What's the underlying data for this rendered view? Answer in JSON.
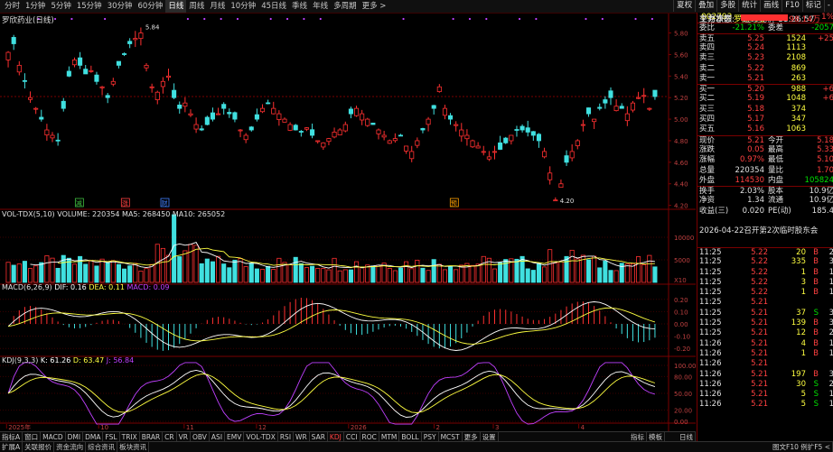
{
  "toolbar": {
    "items": [
      "分时",
      "1分钟",
      "5分钟",
      "15分钟",
      "30分钟",
      "60分钟",
      "日线",
      "周线",
      "月线",
      "10分钟",
      "45日线",
      "季线",
      "年线",
      "多周期",
      "更多 >"
    ],
    "selected": 6,
    "right_tools": [
      "夏权",
      "叠加",
      "多股",
      "统计",
      "画线",
      "F10",
      "标记",
      "-"
    ]
  },
  "chart": {
    "title": "罗欣药业(日线)",
    "high_label": "5.84",
    "low_label": "4.20",
    "price_ticks": [
      "5.80",
      "5.60",
      "5.40",
      "5.20",
      "5.00",
      "4.80",
      "4.60",
      "4.40",
      "4.20"
    ],
    "event_tags": [
      "减",
      "涨",
      "财",
      "预"
    ],
    "vol_label": "VOL-TDX(5,10)",
    "vol_values": "VOLUME: 220354  MA5: 268450  MA10: 265052",
    "vol_ticks": [
      "10000",
      "5000"
    ],
    "vol_unit": "X10",
    "macd_label": "MACD(6,26,9)",
    "macd_dif": "DIF: 0.16",
    "macd_dea": "DEA: 0.11",
    "macd_macd": "MACD: 0.09",
    "macd_ticks": [
      "0.20",
      "0.10",
      "0.00",
      "-0.10",
      "-0.20"
    ],
    "kdj_label": "KDJ(9,3,3)",
    "kdj_k": "K: 61.26",
    "kdj_d": "D: 63.47",
    "kdj_j": "J: 56.84",
    "kdj_ticks": [
      "100.00",
      "80.00",
      "50.00",
      "20.00",
      "0.00"
    ],
    "dates": [
      "2025年",
      "10",
      "11",
      "12",
      "2026",
      "2",
      "3",
      "4"
    ]
  },
  "bottom_tabs": {
    "row1": [
      "指标A",
      "窗口",
      "MACD",
      "DMI",
      "DMA",
      "FSL",
      "TRIX",
      "BRAR",
      "CR",
      "VR",
      "OBV",
      "ASI",
      "EMV",
      "VOL-TDX",
      "RSI",
      "WR",
      "SAR",
      "KDJ",
      "CCI",
      "ROC",
      "MTM",
      "BOLL",
      "PSY",
      "MCST",
      "更多",
      "设置"
    ],
    "row1_right": [
      "指标",
      "模板"
    ],
    "row1_end": "日线",
    "row2": [
      "扩展A",
      "关联报价",
      "资金流向",
      "综合资讯",
      "板块资讯"
    ],
    "row2_right": "图文F10 例扩F5 <"
  },
  "panel": {
    "code": "002793",
    "name": "罗欣药业",
    "weibi_label": "委比",
    "weibi_value": "-21.21%",
    "weicha_label": "委差",
    "weicha_value": "-2057",
    "sells": [
      {
        "label": "卖五",
        "price": "5.25",
        "vol": "1524",
        "chg": "+25"
      },
      {
        "label": "卖四",
        "price": "5.24",
        "vol": "1113",
        "chg": ""
      },
      {
        "label": "卖三",
        "price": "5.23",
        "vol": "2108",
        "chg": ""
      },
      {
        "label": "卖二",
        "price": "5.22",
        "vol": "869",
        "chg": ""
      },
      {
        "label": "卖一",
        "price": "5.21",
        "vol": "263",
        "chg": ""
      }
    ],
    "buys": [
      {
        "label": "买一",
        "price": "5.20",
        "vol": "988",
        "chg": "+6"
      },
      {
        "label": "买二",
        "price": "5.19",
        "vol": "1048",
        "chg": "+6"
      },
      {
        "label": "买三",
        "price": "5.18",
        "vol": "374",
        "chg": ""
      },
      {
        "label": "买四",
        "price": "5.17",
        "vol": "347",
        "chg": ""
      },
      {
        "label": "买五",
        "price": "5.16",
        "vol": "1063",
        "chg": ""
      }
    ],
    "stats": [
      {
        "l1": "现价",
        "v1": "5.21",
        "l2": "今开",
        "v2": "5.18",
        "c1": "red",
        "c2": "red"
      },
      {
        "l1": "涨跌",
        "v1": "0.05",
        "l2": "最高",
        "v2": "5.33",
        "c1": "red",
        "c2": "red"
      },
      {
        "l1": "涨幅",
        "v1": "0.97%",
        "l2": "最低",
        "v2": "5.10",
        "c1": "red",
        "c2": "red"
      },
      {
        "l1": "总量",
        "v1": "220354",
        "l2": "量比",
        "v2": "1.70",
        "c1": "white",
        "c2": "red"
      },
      {
        "l1": "外盘",
        "v1": "114530",
        "l2": "内盘",
        "v2": "105824",
        "c1": "red",
        "c2": "green"
      }
    ],
    "stats2": [
      {
        "l1": "换手",
        "v1": "2.03%",
        "l2": "股本",
        "v2": "10.9亿"
      },
      {
        "l1": "净资",
        "v1": "1.34",
        "l2": "流通",
        "v2": "10.9亿"
      },
      {
        "l1": "收益(三)",
        "v1": "0.020",
        "l2": "PE(动)",
        "v2": "185.4"
      }
    ],
    "trade_status_label": "交易状态:",
    "trade_status": "连续竞价 11:26:57",
    "notice": "2026-04-22召开第2次临时股东会",
    "zhuli_label": "主力净额",
    "zhuli_value": "98.14万",
    "zhuli_pct": "1%",
    "ticks": [
      {
        "t": "11:25",
        "p": "5.22",
        "v": "20",
        "d": "B",
        "n": "2"
      },
      {
        "t": "11:25",
        "p": "5.22",
        "v": "335",
        "d": "B",
        "n": "3"
      },
      {
        "t": "11:25",
        "p": "5.22",
        "v": "1",
        "d": "B",
        "n": "1"
      },
      {
        "t": "11:25",
        "p": "5.22",
        "v": "3",
        "d": "B",
        "n": "1"
      },
      {
        "t": "11:25",
        "p": "5.22",
        "v": "1",
        "d": "B",
        "n": "1"
      },
      {
        "t": "11:25",
        "p": "5.21",
        "v": "",
        "d": "",
        "n": ""
      },
      {
        "t": "11:25",
        "p": "5.21",
        "v": "37",
        "d": "S",
        "n": "3"
      },
      {
        "t": "11:25",
        "p": "5.21",
        "v": "139",
        "d": "B",
        "n": "3"
      },
      {
        "t": "11:25",
        "p": "5.21",
        "v": "12",
        "d": "B",
        "n": "2"
      },
      {
        "t": "11:26",
        "p": "5.21",
        "v": "4",
        "d": "B",
        "n": "1"
      },
      {
        "t": "11:26",
        "p": "5.21",
        "v": "1",
        "d": "B",
        "n": "1"
      },
      {
        "t": "11:26",
        "p": "5.21",
        "v": "",
        "d": "",
        "n": ""
      },
      {
        "t": "11:26",
        "p": "5.21",
        "v": "197",
        "d": "B",
        "n": "3"
      },
      {
        "t": "11:26",
        "p": "5.21",
        "v": "30",
        "d": "S",
        "n": "2"
      },
      {
        "t": "11:26",
        "p": "5.21",
        "v": "5",
        "d": "S",
        "n": "1"
      },
      {
        "t": "11:26",
        "p": "5.21",
        "v": "5",
        "d": "S",
        "n": "1"
      }
    ]
  },
  "colors": {
    "up": "#ff3030",
    "down": "#40e0e0",
    "ma_white": "#ffffff",
    "ma_yellow": "#ffff40",
    "ma_purple": "#c040ff"
  }
}
